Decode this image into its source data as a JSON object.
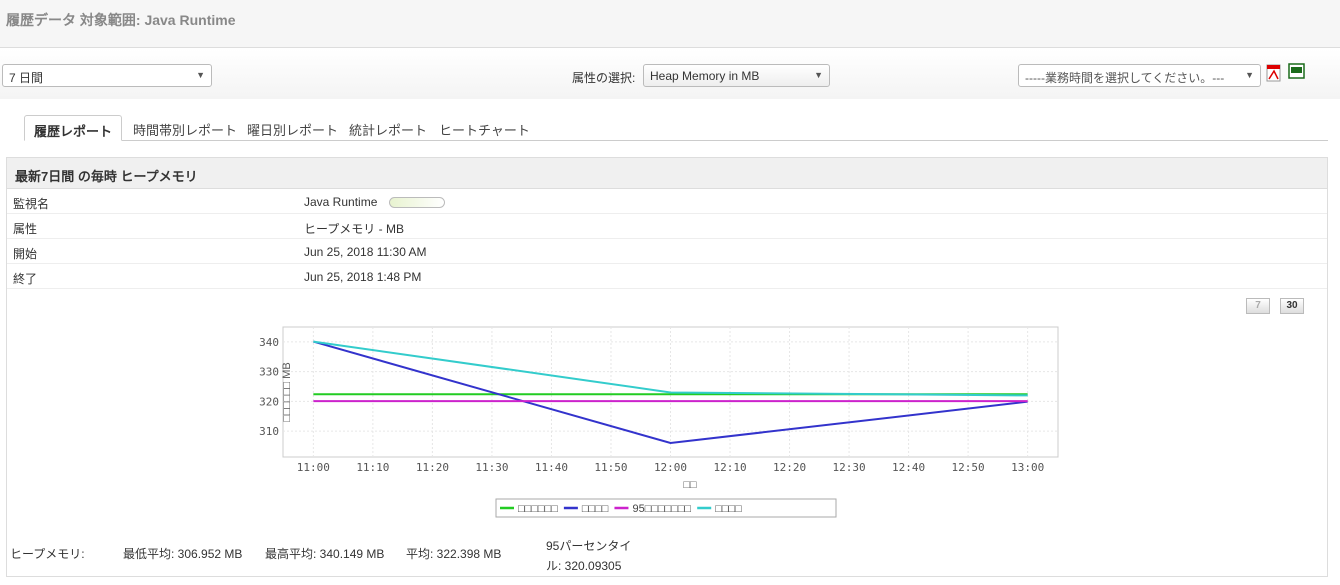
{
  "header": {
    "title": "履歴データ 対象範囲: Java Runtime"
  },
  "filters": {
    "period": "7 日間",
    "attr_label": "属性の選択:",
    "attr_value": "Heap Memory in MB",
    "business_hours": "-----業務時間を選択してください。---"
  },
  "icons": {
    "pdf": "pdf-icon",
    "csv": "csv-icon"
  },
  "tabs": [
    {
      "label": "履歴レポート",
      "active": true
    },
    {
      "label": "時間帯別レポート"
    },
    {
      "label": "曜日別レポート"
    },
    {
      "label": "統計レポート"
    },
    {
      "label": "ヒートチャート"
    }
  ],
  "panel": {
    "title": "最新7日間 の毎時 ヒープメモリ",
    "rows": [
      {
        "k": "監視名",
        "v": "Java Runtime"
      },
      {
        "k": "属性",
        "v": "ヒープメモリ - MB"
      },
      {
        "k": "開始",
        "v": "Jun 25, 2018 11:30 AM"
      },
      {
        "k": "終了",
        "v": "Jun 25, 2018 1:48 PM"
      }
    ],
    "pager": {
      "p7": "7",
      "p30": "30"
    }
  },
  "chart_data": {
    "type": "line",
    "xlabel": "□□",
    "ylabel": "□□□□□□ MB",
    "x_ticks": [
      "11:00",
      "11:10",
      "11:20",
      "11:30",
      "11:40",
      "11:50",
      "12:00",
      "12:10",
      "12:20",
      "12:30",
      "12:40",
      "12:50",
      "13:00"
    ],
    "x_minutes": [
      0,
      60,
      120
    ],
    "xlim": [
      -5.1,
      125.1
    ],
    "ylim": [
      301.3,
      345
    ],
    "y_ticks": [
      310,
      320,
      330,
      340
    ],
    "grid": true,
    "legend": "bottom",
    "series": [
      {
        "name": "□□□□□□",
        "color": "#22cc22",
        "values": [
          322.4,
          322.4,
          322.4
        ]
      },
      {
        "name": "□□□□",
        "color": "#3333cc",
        "values": [
          340.1,
          306.0,
          319.9
        ]
      },
      {
        "name": "95□□□□□□□",
        "color": "#cc22cc",
        "values": [
          320.1,
          320.1,
          320.1
        ]
      },
      {
        "name": "□□□□",
        "color": "#33cccc",
        "values": [
          340.1,
          323.0,
          322.0
        ]
      }
    ]
  },
  "stats": {
    "label": "ヒープメモリ:",
    "min": "最低平均: 306.952 MB",
    "max": "最高平均: 340.149 MB",
    "avg": "平均: 322.398 MB",
    "p95a": "95パーセンタイ",
    "p95b": "ル: 320.09305"
  }
}
